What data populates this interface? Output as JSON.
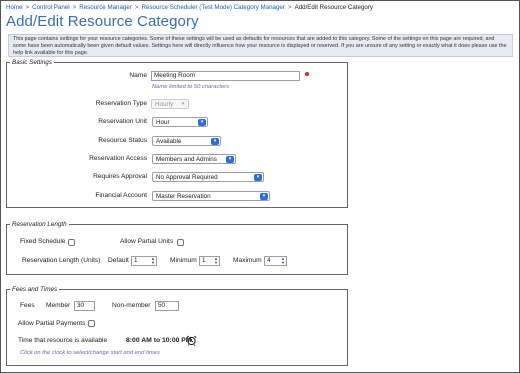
{
  "breadcrumb": {
    "items": [
      "Home",
      "Control Panel",
      "Resource Manager",
      "Resource Scheduler (Test Mode) Category Manager"
    ],
    "current": "Add/Edit Resource Category",
    "separator": ">"
  },
  "page": {
    "title": "Add/Edit Resource Category",
    "intro": "This page contains settings for your resource categories. Some of these settings will be used as defaults for resources that are added to this category. Some of the settings on this page are required, and some have been automatically been given default values. Settings here will directly influence how your resource is displayed or reserved. If you are unsure of any setting or exactly what it does please use the help link available for this page."
  },
  "basic": {
    "legend": "Basic Settings",
    "name_label": "Name",
    "name_value": "Meeting Room",
    "name_hint": "Name limited to 50 characters",
    "reservation_type_label": "Reservation Type",
    "reservation_type_value": "Hourly",
    "reservation_unit_label": "Reservation Unit",
    "reservation_unit_value": "Hour",
    "resource_status_label": "Resource Status",
    "resource_status_value": "Available",
    "reservation_access_label": "Reservation Access",
    "reservation_access_value": "Members and Admins",
    "requires_approval_label": "Requires Approval",
    "requires_approval_value": "No Approval Required",
    "financial_account_label": "Financial Account",
    "financial_account_value": "Master Reservation"
  },
  "length": {
    "legend": "Reservation Length",
    "fixed_schedule_label": "Fixed Schedule",
    "allow_partial_units_label": "Allow Partial Units",
    "units_label": "Reservation Length (Units)",
    "default_label": "Default",
    "default_value": "1",
    "minimum_label": "Minimum",
    "minimum_value": "1",
    "maximum_label": "Maximum",
    "maximum_value": "4"
  },
  "fees": {
    "legend": "Fees and Times",
    "fees_label": "Fees",
    "member_label": "Member",
    "member_value": "30",
    "nonmember_label": "Non-member",
    "nonmember_value": "50",
    "allow_partial_payments_label": "Allow Partial Payments",
    "time_label": "Time that resource is available",
    "time_value": "8:00 AM to 10:00 PM",
    "time_hint": "Click on the clock to select/change start and end times"
  },
  "colors": {
    "link": "#1f5fa8",
    "title": "#3a6fb0",
    "intro_bg": "#e7eaf3",
    "hint": "#7a5fa8",
    "select_button": "#2c6fd6",
    "required": "#d9262c"
  },
  "icons": {
    "required": "required-dot-icon",
    "clock": "alarm-clock-icon",
    "dropdown": "chevron-updown-icon"
  }
}
